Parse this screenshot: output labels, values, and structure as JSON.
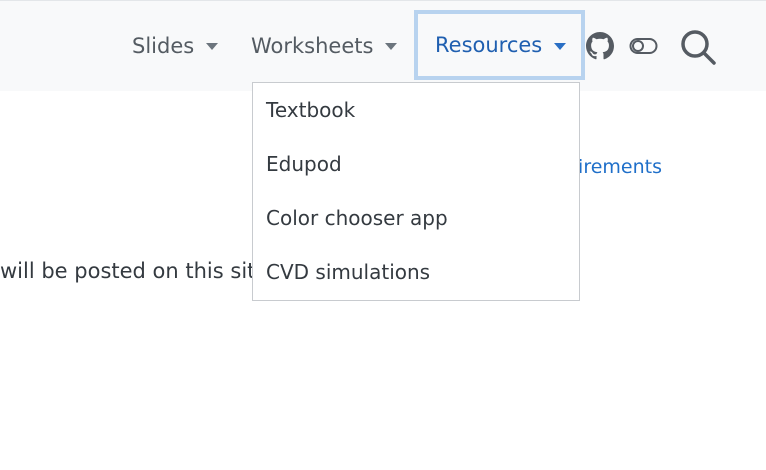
{
  "navbar": {
    "items": [
      {
        "label": "Slides"
      },
      {
        "label": "Worksheets"
      },
      {
        "label": "Resources",
        "active": true
      }
    ],
    "icons": [
      "github-icon",
      "toggle-icon",
      "search-icon"
    ],
    "accent_color": "#1f5fb0"
  },
  "dropdown": {
    "items": [
      {
        "label": "Textbook"
      },
      {
        "label": "Edupod"
      },
      {
        "label": "Color chooser app"
      },
      {
        "label": "CVD simulations"
      }
    ]
  },
  "background": {
    "link_text": "uirements",
    "body_text": "will be posted on this sit"
  }
}
